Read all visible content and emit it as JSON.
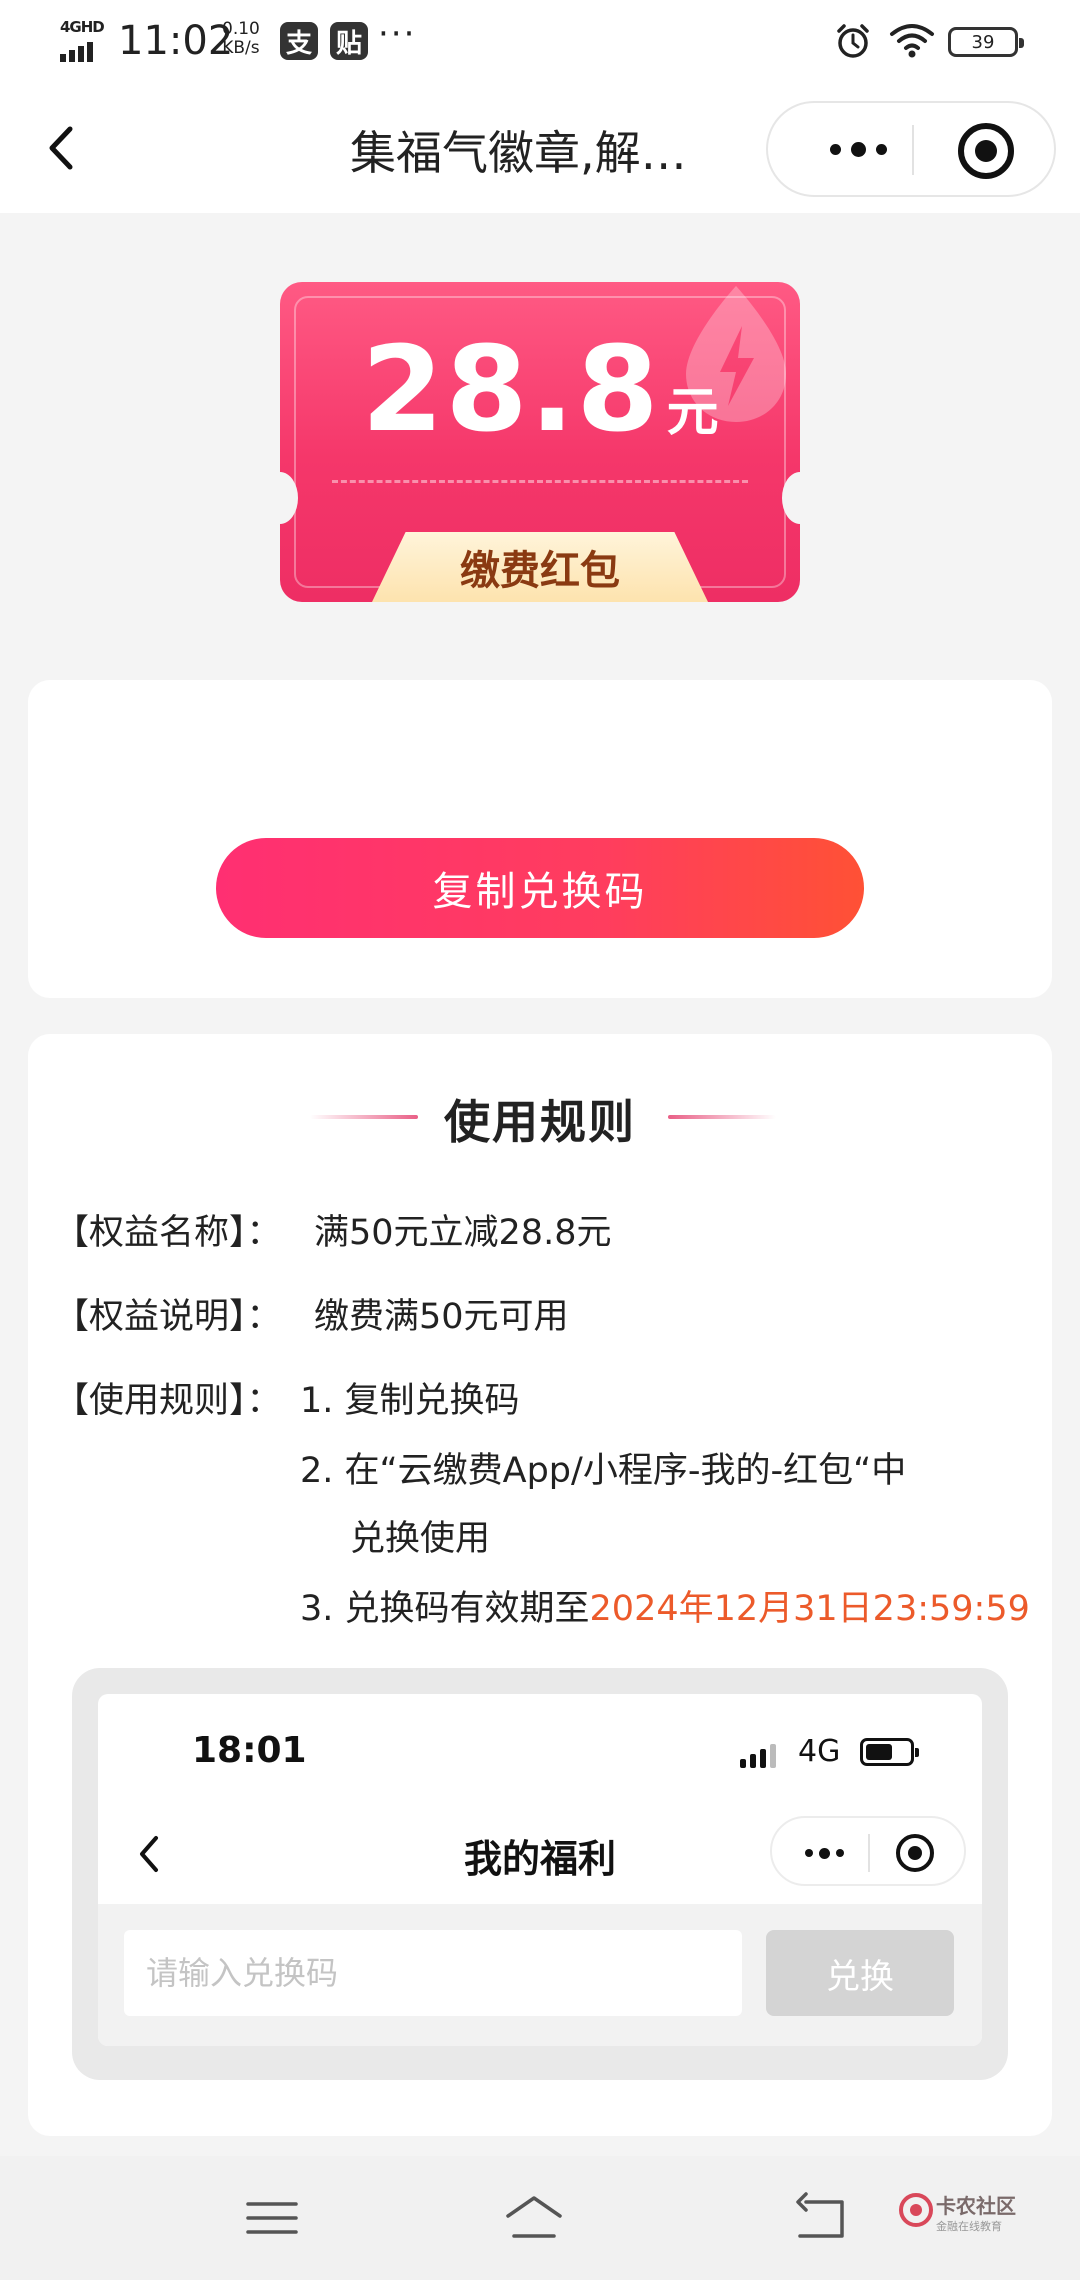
{
  "status_bar": {
    "network": "4GHD",
    "time": "11:02",
    "speed_value": "0.10",
    "speed_unit": "KB/s",
    "badge1": "支",
    "badge2": "贴",
    "more": "···",
    "battery": "39"
  },
  "nav": {
    "title": "集福气徽章,解…"
  },
  "coupon": {
    "amount": "28.8",
    "unit": "元",
    "label": "缴费红包"
  },
  "action": {
    "copy_label": "复制兑换码"
  },
  "rules": {
    "title": "使用规则",
    "items": [
      {
        "key": "【权益名称】：",
        "value": "满50元立减28.8元"
      },
      {
        "key": "【权益说明】：",
        "value": "缴费满50元可用"
      },
      {
        "key": "【使用规则】：",
        "value": "1. 复制兑换码"
      }
    ],
    "step2_line1": "2. 在“云缴费App/小程序-我的-红包“中",
    "step2_line2": "兑换使用",
    "step3_prefix": "3. 兑换码有效期至",
    "step3_date": "2024年12月31日23:59:59"
  },
  "example": {
    "time": "18:01",
    "network": "4G",
    "title": "我的福利",
    "input_placeholder": "请输入兑换码",
    "button_label": "兑换"
  },
  "watermark": {
    "text": "卡农社区",
    "sub": "金融在线教育"
  },
  "colors": {
    "coupon_pink": "#f5376a",
    "button_gradient_start": "#ff2f72",
    "button_gradient_end": "#ff5135",
    "highlight": "#ec5a2a"
  },
  "icons": [
    "back-arrow-icon",
    "more-dots-icon",
    "close-target-icon",
    "alarm-icon",
    "wifi-icon",
    "battery-icon",
    "menu-icon",
    "home-icon",
    "return-icon"
  ]
}
